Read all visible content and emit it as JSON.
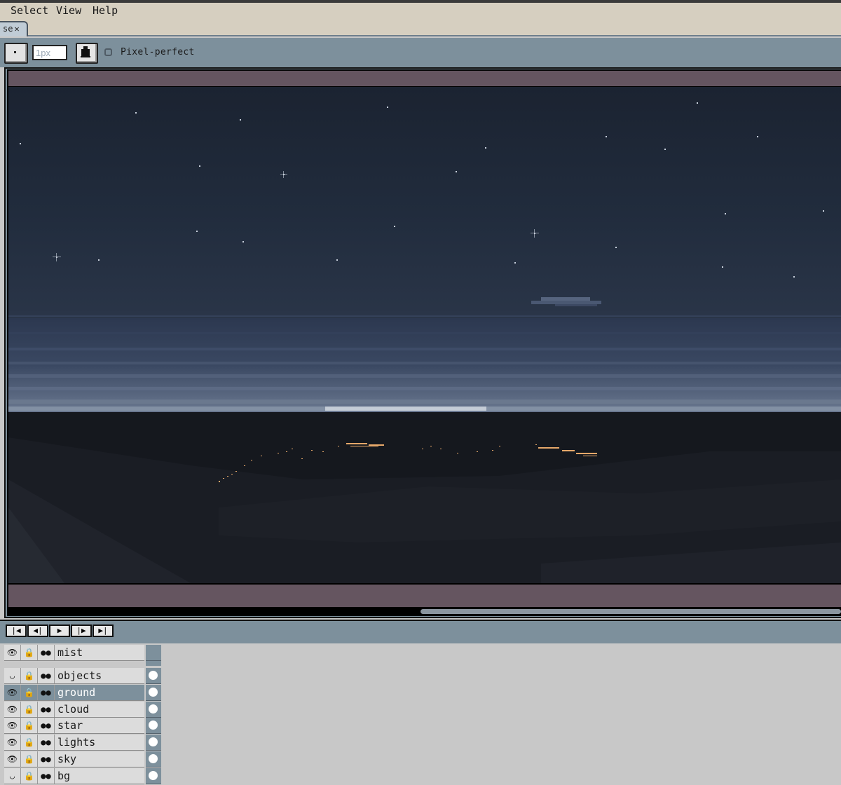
{
  "menu": {
    "items": [
      "Select",
      "View",
      "Help"
    ],
    "underline": [
      "S",
      "V",
      "H"
    ]
  },
  "tab": {
    "label": "se",
    "close": "✕"
  },
  "tool_options": {
    "size_value": "1px",
    "pixel_perfect_label": "Pixel-perfect",
    "pixel_perfect_checked": false
  },
  "timeline": {
    "buttons": [
      "first-frame",
      "prev-frame",
      "play",
      "next-frame",
      "last-frame"
    ],
    "current_frame": "1",
    "layers": [
      {
        "name": "mist",
        "visible": true,
        "locked": true,
        "selected": false
      },
      {
        "name": "objects",
        "visible": false,
        "locked": true,
        "selected": false
      },
      {
        "name": "ground",
        "visible": true,
        "locked": true,
        "selected": true
      },
      {
        "name": "cloud",
        "visible": true,
        "locked": true,
        "selected": false
      },
      {
        "name": "star",
        "visible": true,
        "locked": true,
        "selected": false
      },
      {
        "name": "lights",
        "visible": true,
        "locked": true,
        "selected": false
      },
      {
        "name": "sky",
        "visible": true,
        "locked": true,
        "selected": false
      },
      {
        "name": "bg",
        "visible": false,
        "locked": true,
        "selected": false
      }
    ]
  },
  "colors": {
    "ui_panel": "#7d909c",
    "canvas_pad": "#655560",
    "sky": "#1e2838",
    "sea": "#3e4c66",
    "ground": "#15181e",
    "city_lights": "#e6a86a"
  }
}
